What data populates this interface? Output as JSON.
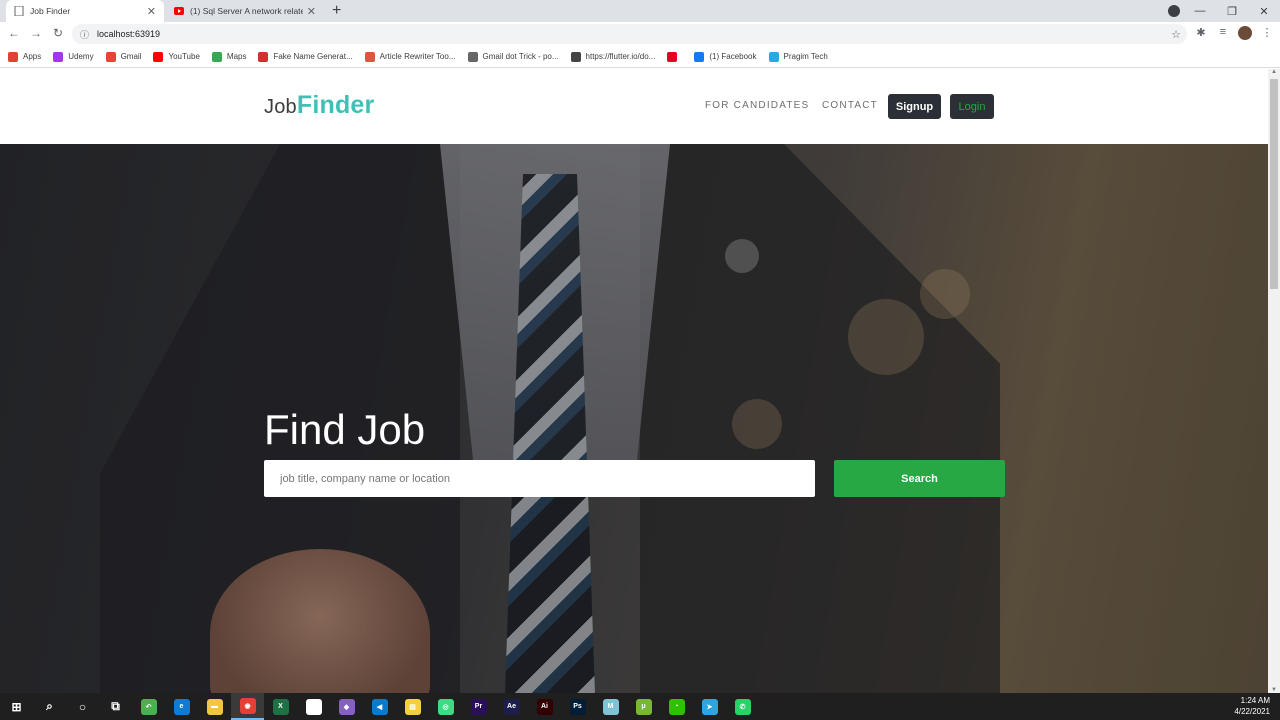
{
  "browser": {
    "tabs": [
      {
        "title": "Job Finder",
        "active": true
      },
      {
        "title": "(1) Sql Server A network related ...",
        "active": false
      }
    ],
    "new_tab": "+",
    "url": "localhost:63919",
    "bookmarks": [
      {
        "label": "Apps",
        "icon": "apps-grid-icon",
        "color": "#e44134"
      },
      {
        "label": "Udemy",
        "icon": "udemy-icon",
        "color": "#a435f0"
      },
      {
        "label": "Gmail",
        "icon": "gmail-icon",
        "color": "#ea4335"
      },
      {
        "label": "YouTube",
        "icon": "youtube-icon",
        "color": "#ff0000"
      },
      {
        "label": "Maps",
        "icon": "maps-pin-icon",
        "color": "#34a853"
      },
      {
        "label": "Fake Name Generat...",
        "icon": "fake-name-icon",
        "color": "#d32f2f"
      },
      {
        "label": "Article Rewriter Too...",
        "icon": "article-rewriter-icon",
        "color": "#e0533d"
      },
      {
        "label": "Gmail dot Trick - po...",
        "icon": "gmail-dot-icon",
        "color": "#666666"
      },
      {
        "label": "https://flutter.io/do...",
        "icon": "globe-icon",
        "color": "#444444"
      },
      {
        "label": "",
        "icon": "pinterest-icon",
        "color": "#e60023"
      },
      {
        "label": "(1) Facebook",
        "icon": "facebook-icon",
        "color": "#1877f2"
      },
      {
        "label": "Pragim Tech",
        "icon": "pragim-icon",
        "color": "#27a9e1"
      }
    ]
  },
  "site": {
    "logo_light": "Job",
    "logo_bold": "Finder",
    "nav": {
      "candidates": "FOR CANDIDATES",
      "contact": "CONTACT",
      "signup": "Signup",
      "login": "Login"
    },
    "hero": {
      "title": "Find Job",
      "search_placeholder": "job title, company name or location",
      "search_button": "Search"
    }
  },
  "taskbar": {
    "apps": [
      {
        "name": "windows-start-icon",
        "glyph": "⊞",
        "color": "#ffffff"
      },
      {
        "name": "search-icon",
        "glyph": "⌕",
        "color": "#ffffff"
      },
      {
        "name": "cortana-icon",
        "glyph": "○",
        "color": "#ffffff"
      },
      {
        "name": "task-view-icon",
        "glyph": "⧉",
        "color": "#ffffff"
      },
      {
        "name": "undo-app-icon",
        "glyph": "↶",
        "color": "#4caf50"
      },
      {
        "name": "edge-icon",
        "glyph": "e",
        "color": "#0f7bd6"
      },
      {
        "name": "file-explorer-icon",
        "glyph": "▬",
        "color": "#f4c542"
      },
      {
        "name": "chrome-icon",
        "glyph": "◉",
        "color": "#e44134"
      },
      {
        "name": "excel-icon",
        "glyph": "X",
        "color": "#1e7145"
      },
      {
        "name": "app-icon",
        "glyph": "◐",
        "color": "#ffffff"
      },
      {
        "name": "visual-studio-icon",
        "glyph": "◆",
        "color": "#865fc5"
      },
      {
        "name": "vscode-icon",
        "glyph": "◀",
        "color": "#0a7acc"
      },
      {
        "name": "sticky-notes-icon",
        "glyph": "▤",
        "color": "#f4d03f"
      },
      {
        "name": "android-studio-icon",
        "glyph": "◎",
        "color": "#3ddc84"
      },
      {
        "name": "premiere-icon",
        "glyph": "Pr",
        "color": "#2a0f5a"
      },
      {
        "name": "after-effects-icon",
        "glyph": "Ae",
        "color": "#1e1e4a"
      },
      {
        "name": "illustrator-icon",
        "glyph": "Ai",
        "color": "#330000"
      },
      {
        "name": "photoshop-icon",
        "glyph": "Ps",
        "color": "#001e36"
      },
      {
        "name": "mdi-icon",
        "glyph": "M",
        "color": "#7fc4d4"
      },
      {
        "name": "utorrent-icon",
        "glyph": "μ",
        "color": "#78b833"
      },
      {
        "name": "wechat-icon",
        "glyph": "◔",
        "color": "#2dc100"
      },
      {
        "name": "telegram-icon",
        "glyph": "➤",
        "color": "#2ca5e0"
      },
      {
        "name": "whatsapp-icon",
        "glyph": "✆",
        "color": "#25d366"
      }
    ],
    "time": "1:24 AM",
    "date": "4/22/2021"
  }
}
